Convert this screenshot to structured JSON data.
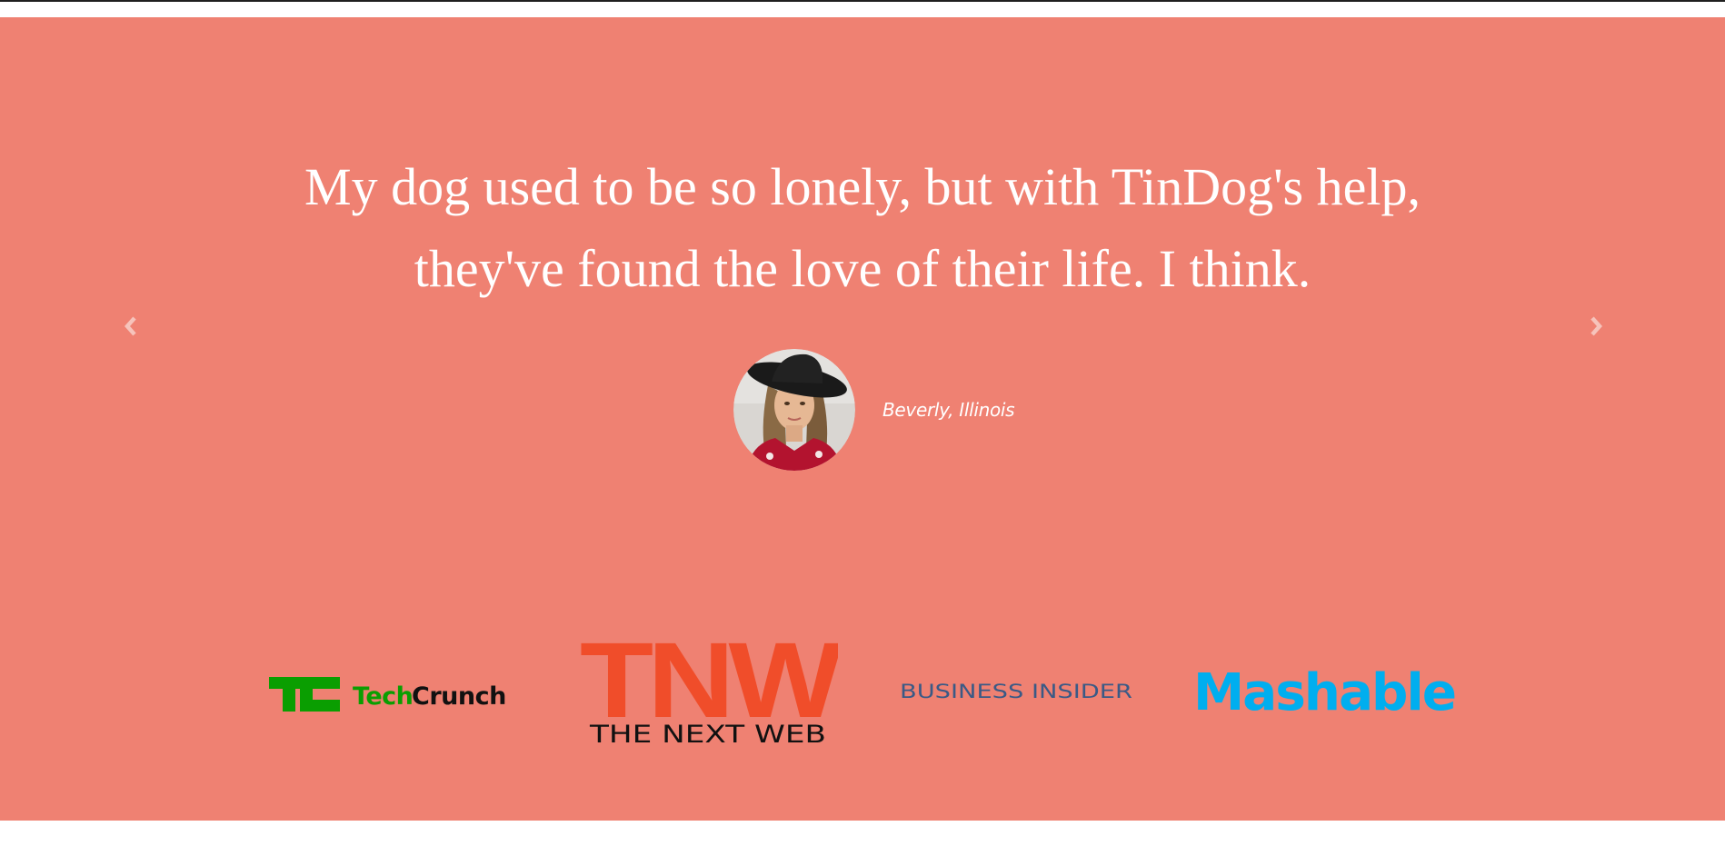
{
  "testimonial": {
    "quote_line1": "My dog used to be so lonely, but with TinDog's help,",
    "quote_line2": "they've found the love of their life. I think.",
    "author": "Beverly, Illinois",
    "avatar_alt": "Beverly profile photo"
  },
  "carousel": {
    "prev_icon": "chevron-left-icon",
    "next_icon": "chevron-right-icon"
  },
  "press": {
    "techcrunch_word1": "Tech",
    "techcrunch_word2": "Crunch",
    "tnw_mark": "TNW",
    "tnw_name": "THE NEXT WEB",
    "business_insider": "BUSINESS INSIDER",
    "mashable": "Mashable"
  },
  "colors": {
    "section_bg": "#ef8172",
    "techcrunch_green": "#0a9e01",
    "tnw_orange": "#f04d2a",
    "business_insider_blue": "#3a5a86",
    "mashable_blue": "#00aeef"
  }
}
